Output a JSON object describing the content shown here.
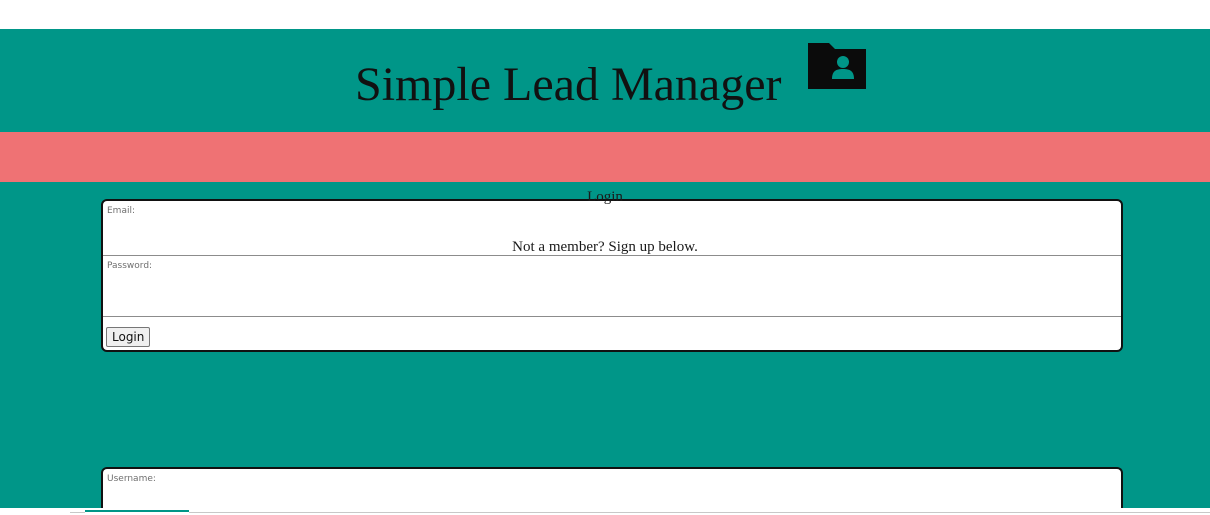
{
  "header": {
    "title": "Simple Lead Manager",
    "icon": "folder-user-icon"
  },
  "colors": {
    "primary": "#009688",
    "banner": "#ef7274",
    "card": "#ffffff",
    "card_border": "#111111"
  },
  "login_form": {
    "email_label": "Email:",
    "email_value": "",
    "password_label": "Password:",
    "password_value": "",
    "submit_label": "Login"
  },
  "login_heading": "Login",
  "signup_prompt": "Not a member? Sign up below.",
  "signup_form": {
    "username_label": "Username:",
    "username_value": ""
  }
}
